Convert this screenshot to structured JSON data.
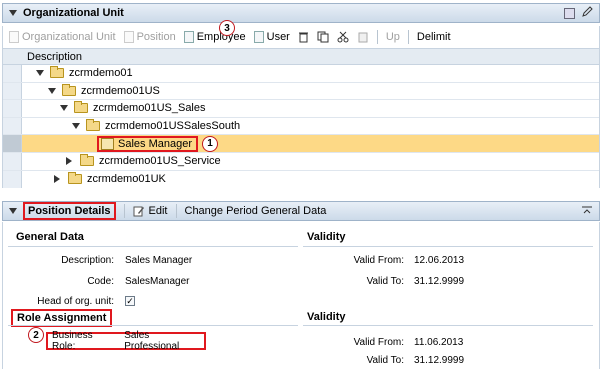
{
  "org_panel": {
    "title": "Organizational Unit",
    "toolbar": {
      "org_unit": "Organizational Unit",
      "position": "Position",
      "employee": "Employee",
      "user": "User",
      "up": "Up",
      "delimit": "Delimit"
    },
    "column_header": "Description",
    "rows": [
      {
        "label": "zcrmdemo01"
      },
      {
        "label": "zcrmdemo01US"
      },
      {
        "label": "zcrmdemo01US_Sales"
      },
      {
        "label": "zcrmdemo01USSalesSouth"
      },
      {
        "label": "Sales Manager"
      },
      {
        "label": "zcrmdemo01US_Service"
      },
      {
        "label": "zcrmdemo01UK"
      }
    ]
  },
  "details_panel": {
    "title": "Position Details",
    "edit": "Edit",
    "change_period": "Change Period General Data",
    "general_data": {
      "title": "General Data",
      "description_label": "Description:",
      "description_value": "Sales Manager",
      "code_label": "Code:",
      "code_value": "SalesManager",
      "head_label": "Head of org. unit:",
      "head_checked": true
    },
    "validity1": {
      "title": "Validity",
      "from_label": "Valid From:",
      "from_value": "12.06.2013",
      "to_label": "Valid To:",
      "to_value": "31.12.9999"
    },
    "role_assignment": {
      "title": "Role Assignment",
      "business_role_label": "Business Role:",
      "business_role_value": "Sales Professional"
    },
    "validity2": {
      "title": "Validity",
      "from_label": "Valid From:",
      "from_value": "11.06.2013",
      "to_label": "Valid To:",
      "to_value": "31.12.9999"
    }
  },
  "callouts": {
    "one": "1",
    "two": "2",
    "three": "3"
  }
}
